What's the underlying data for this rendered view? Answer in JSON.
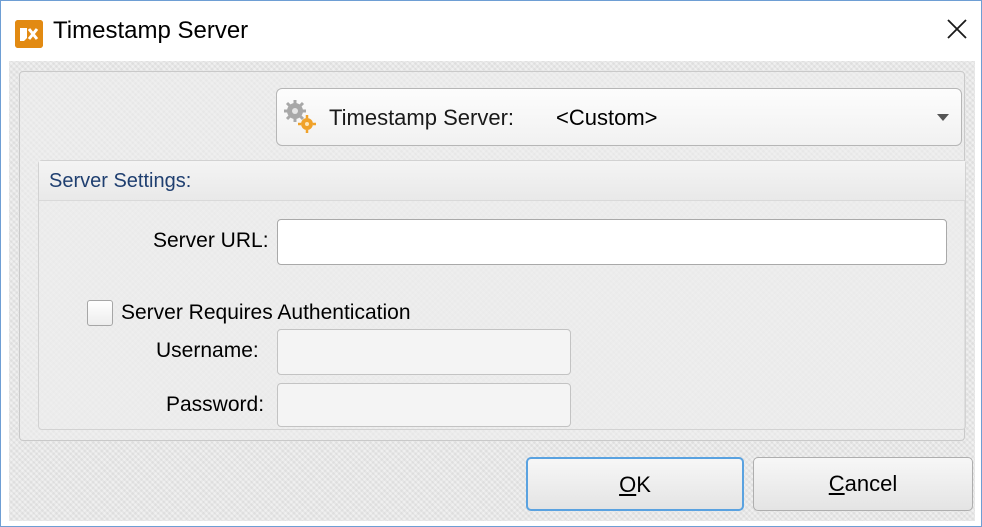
{
  "window": {
    "title": "Timestamp Server",
    "app_icon": "pdf-xchange-icon",
    "close_icon": "close-icon"
  },
  "server": {
    "label": "Timestamp Server:",
    "selected_value": "<Custom>",
    "icon": "gear-icon"
  },
  "settings": {
    "group_title": "Server Settings:",
    "server_url_label": "Server URL:",
    "server_url_value": "",
    "auth_checkbox_label": "Server Requires Authentication",
    "auth_checked": false,
    "username_label": "Username:",
    "username_value": "",
    "password_label": "Password:",
    "password_value": ""
  },
  "buttons": {
    "ok_mnemonic": "O",
    "ok_rest": "K",
    "cancel_mnemonic": "C",
    "cancel_rest": "ancel"
  }
}
